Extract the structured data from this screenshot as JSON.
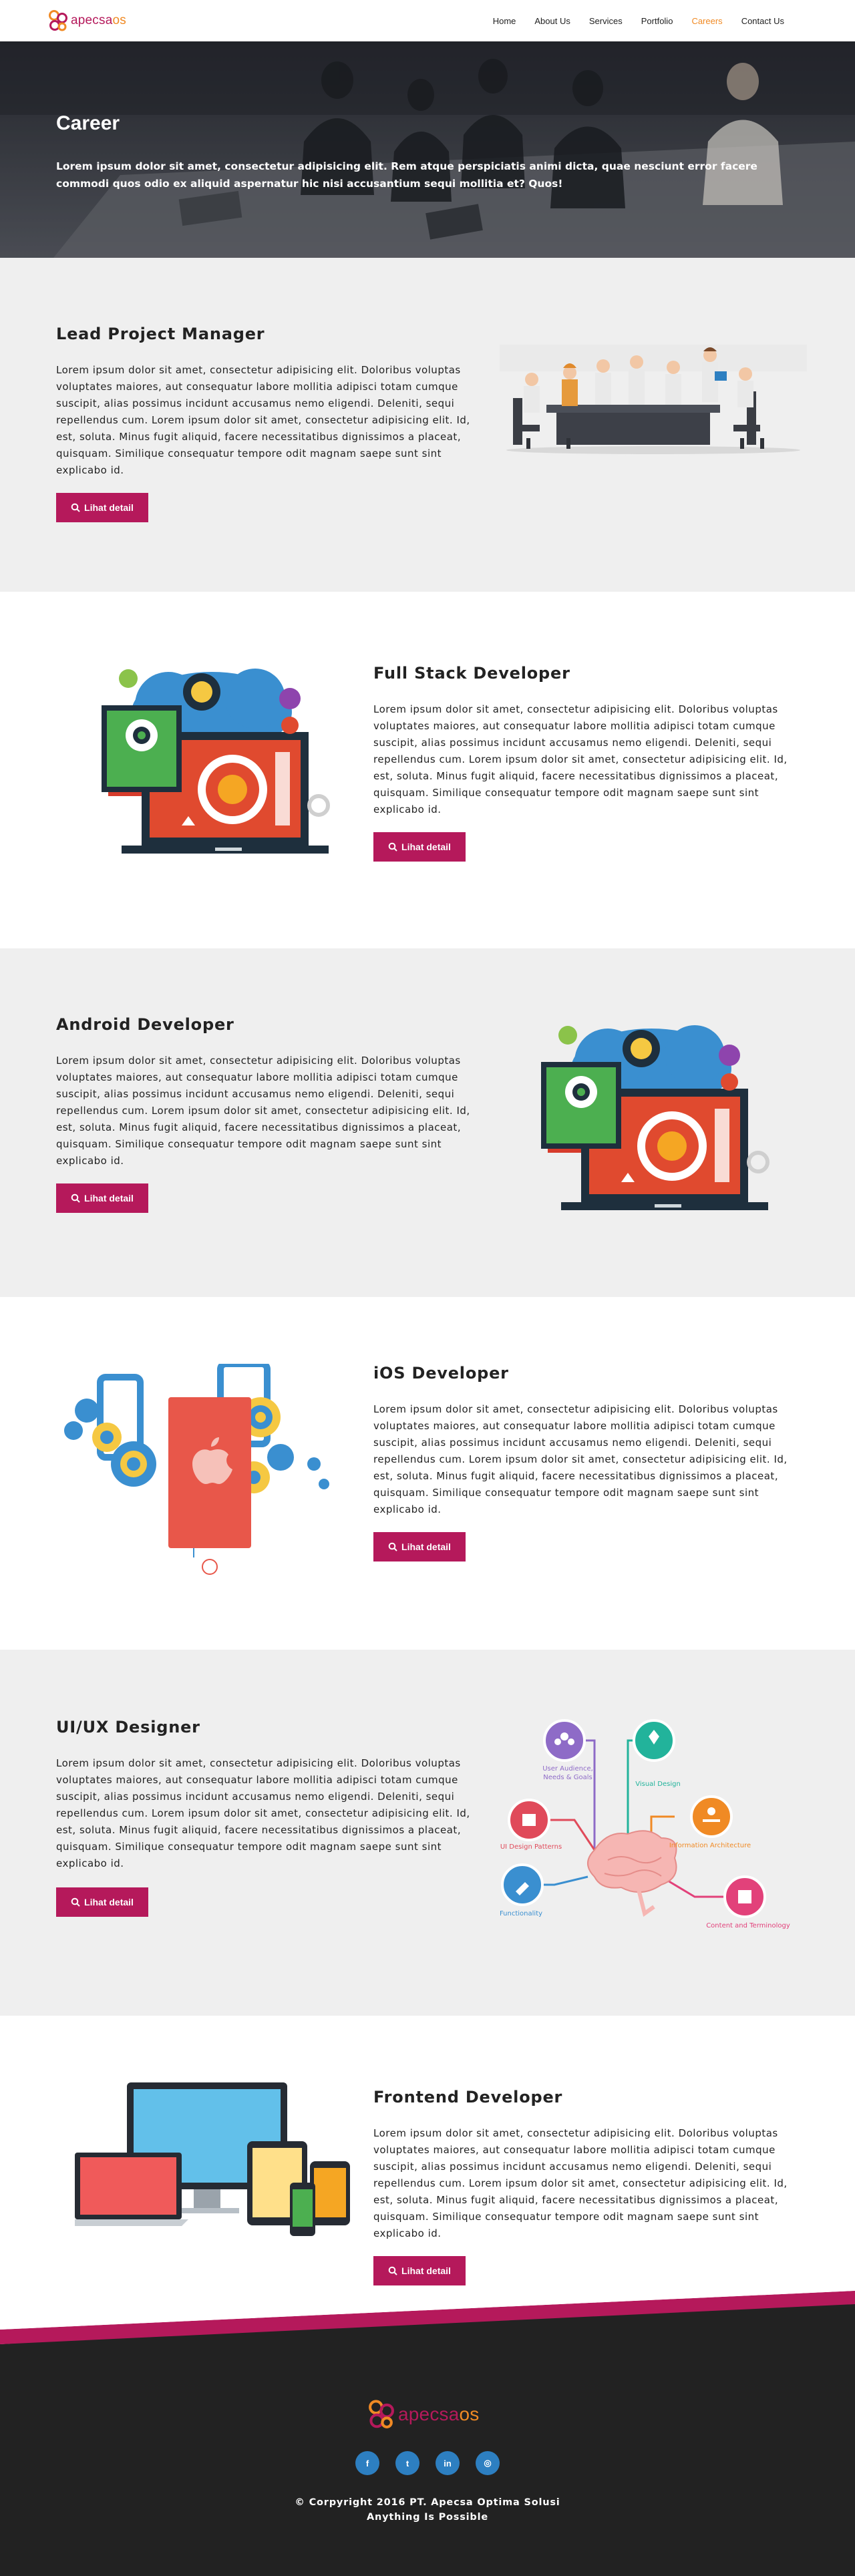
{
  "brand": {
    "name_main": "apecsa",
    "name_suffix": "os",
    "colors": {
      "primary": "#b5195b",
      "accent": "#f08a24",
      "footer": "#222222",
      "section_grey": "#efefef"
    }
  },
  "nav": {
    "items": [
      {
        "label": "Home"
      },
      {
        "label": "About Us"
      },
      {
        "label": "Services"
      },
      {
        "label": "Portfolio"
      },
      {
        "label": "Careers",
        "active": true
      },
      {
        "label": "Contact Us"
      }
    ]
  },
  "hero": {
    "title": "Career",
    "subtitle": "Lorem ipsum dolor sit amet, consectetur adipisicing elit. Rem atque perspiciatis animi dicta, quae nesciunt error facere commodi quos odio ex aliquid aspernatur hic nisi accusantium sequi mollitia et? Quos!"
  },
  "jobs": [
    {
      "title": "Lead Project Manager",
      "illustration": "meeting-illustration",
      "button": "Lihat detail",
      "description": "Lorem ipsum dolor sit amet, consectetur adipisicing elit. Doloribus voluptas voluptates maiores, aut consequatur labore mollitia adipisci totam cumque suscipit, alias possimus incidunt accusamus nemo eligendi. Deleniti, sequi repellendus cum. Lorem ipsum dolor sit amet, consectetur adipisicing elit. Id, est, soluta. Minus fugit aliquid, facere necessitatibus dignissimos a placeat, quisquam. Similique consequatur tempore odit magnam saepe sunt sint explicabo id."
    },
    {
      "title": "Full Stack Developer",
      "illustration": "gears-laptop-illustration",
      "button": "Lihat detail",
      "description": "Lorem ipsum dolor sit amet, consectetur adipisicing elit. Doloribus voluptas voluptates maiores, aut consequatur labore mollitia adipisci totam cumque suscipit, alias possimus incidunt accusamus nemo eligendi. Deleniti, sequi repellendus cum. Lorem ipsum dolor sit amet, consectetur adipisicing elit. Id, est, soluta. Minus fugit aliquid, facere necessitatibus dignissimos a placeat, quisquam. Similique consequatur tempore odit magnam saepe sunt sint explicabo id."
    },
    {
      "title": "Android Developer",
      "illustration": "gears-laptop-illustration",
      "button": "Lihat detail",
      "description": "Lorem ipsum dolor sit amet, consectetur adipisicing elit. Doloribus voluptas voluptates maiores, aut consequatur labore mollitia adipisci totam cumque suscipit, alias possimus incidunt accusamus nemo eligendi. Deleniti, sequi repellendus cum. Lorem ipsum dolor sit amet, consectetur adipisicing elit. Id, est, soluta. Minus fugit aliquid, facere necessitatibus dignissimos a placeat, quisquam. Similique consequatur tempore odit magnam saepe sunt sint explicabo id."
    },
    {
      "title": "iOS Developer",
      "illustration": "phone-gears-illustration",
      "button": "Lihat detail",
      "description": "Lorem ipsum dolor sit amet, consectetur adipisicing elit. Doloribus voluptas voluptates maiores, aut consequatur labore mollitia adipisci totam cumque suscipit, alias possimus incidunt accusamus nemo eligendi. Deleniti, sequi repellendus cum. Lorem ipsum dolor sit amet, consectetur adipisicing elit. Id, est, soluta. Minus fugit aliquid, facere necessitatibus dignissimos a placeat, quisquam. Similique consequatur tempore odit magnam saepe sunt sint explicabo id."
    },
    {
      "title": "UI/UX Designer",
      "illustration": "uxui-brain-diagram",
      "button": "Lihat detail",
      "description": "Lorem ipsum dolor sit amet, consectetur adipisicing elit. Doloribus voluptas voluptates maiores, aut consequatur labore mollitia adipisci totam cumque suscipit, alias possimus incidunt accusamus nemo eligendi. Deleniti, sequi repellendus cum. Lorem ipsum dolor sit amet, consectetur adipisicing elit. Id, est, soluta. Minus fugit aliquid, facere necessitatibus dignissimos a placeat, quisquam. Similique consequatur tempore odit magnam saepe sunt sint explicabo id.",
      "diagram_labels": [
        "User Audience, Needs & Goals",
        "Visual Design",
        "UI Design Patterns",
        "Information Architecture",
        "Content and Terminology",
        "Functionality"
      ]
    },
    {
      "title": "Frontend Developer",
      "illustration": "devices-illustration",
      "button": "Lihat detail",
      "description": "Lorem ipsum dolor sit amet, consectetur adipisicing elit. Doloribus voluptas voluptates maiores, aut consequatur labore mollitia adipisci totam cumque suscipit, alias possimus incidunt accusamus nemo eligendi. Deleniti, sequi repellendus cum. Lorem ipsum dolor sit amet, consectetur adipisicing elit. Id, est, soluta. Minus fugit aliquid, facere necessitatibus dignissimos a placeat, quisquam. Similique consequatur tempore odit magnam saepe sunt sint explicabo id."
    }
  ],
  "footer": {
    "socials": [
      {
        "label": "f",
        "icon": "facebook-icon"
      },
      {
        "label": "t",
        "icon": "twitter-icon"
      },
      {
        "label": "in",
        "icon": "linkedin-icon"
      },
      {
        "label": "◎",
        "icon": "instagram-icon"
      }
    ],
    "copyright_line1": "© Corpyright 2016 PT. Apecsa Optima Solusi",
    "copyright_line2": "Anything Is Possible"
  }
}
